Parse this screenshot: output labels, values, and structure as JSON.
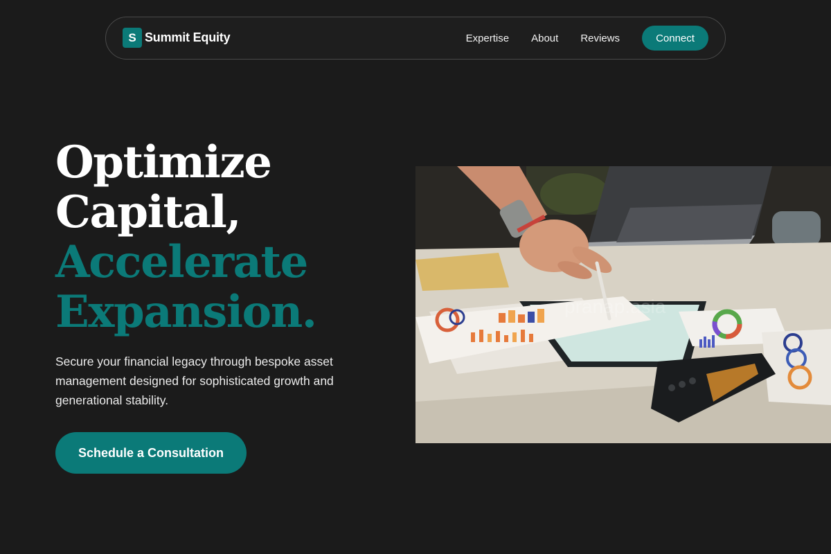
{
  "brand": {
    "mark": "S",
    "name": "Summit Equity"
  },
  "nav": {
    "links": [
      "Expertise",
      "About",
      "Reviews"
    ],
    "cta": "Connect"
  },
  "hero": {
    "headline_lines": [
      "Optimize",
      "Capital,",
      "Accelerate",
      "Expansion."
    ],
    "subtext": "Secure your financial legacy through bespoke asset management designed for sophisticated growth and generational stability.",
    "cta": "Schedule a Consultation"
  },
  "image": {
    "description_icon": "financial-charts-photo-icon",
    "watermark": "pranap.asia"
  },
  "colors": {
    "background": "#1b1b1b",
    "accent": "#0b7a78",
    "text": "#ffffff"
  }
}
